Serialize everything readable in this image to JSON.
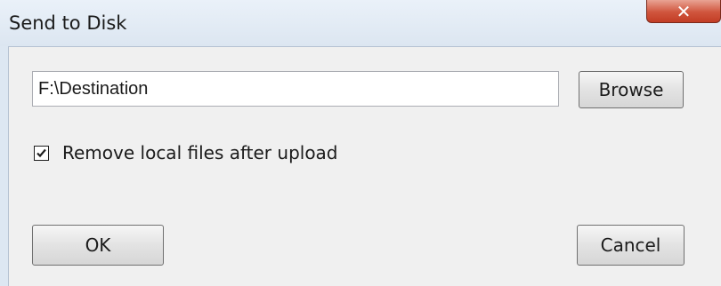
{
  "window": {
    "title": "Send to Disk",
    "close_icon": "close-icon"
  },
  "destination": {
    "value": "F:\\Destination",
    "browse_label": "Browse"
  },
  "options": {
    "remove_local_files": {
      "label": "Remove local files after upload",
      "checked": true
    }
  },
  "buttons": {
    "ok_label": "OK",
    "cancel_label": "Cancel"
  },
  "colors": {
    "client_bg": "#f0f0f0",
    "titlebar_bg": "#dde7f2",
    "close_button": "#c94a33"
  }
}
